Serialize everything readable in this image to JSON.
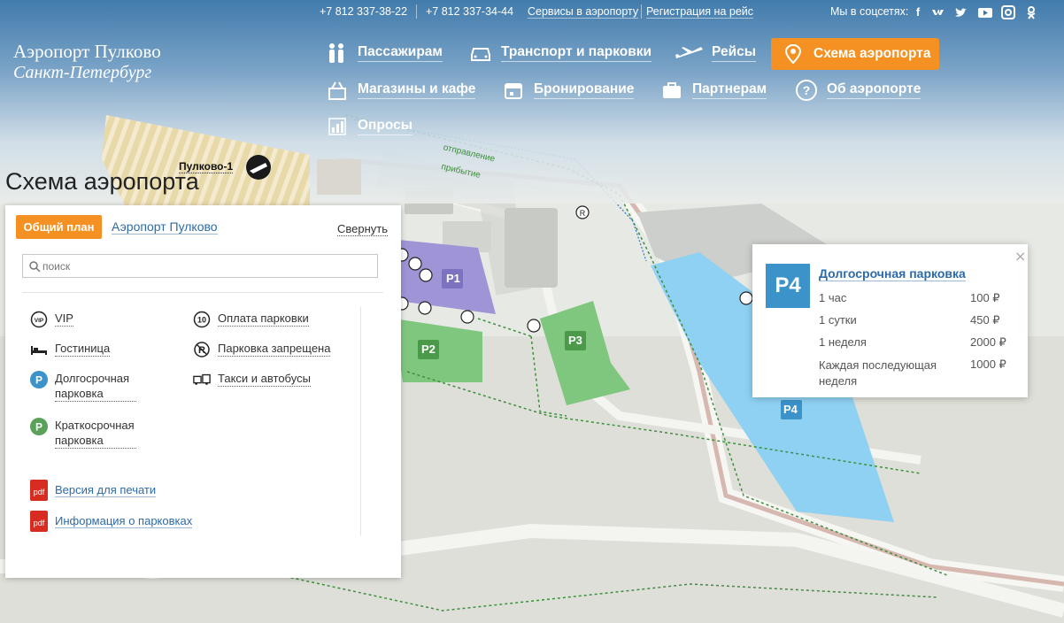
{
  "topbar": {
    "phone1": "+7 812 337-38-22",
    "phone2": "+7 812 337-34-44",
    "services_link": "Сервисы в аэропорту",
    "checkin_link": "Регистрация на рейс",
    "social_label": "Мы в соцсетях:",
    "social_icons": [
      "facebook-icon",
      "vk-icon",
      "twitter-icon",
      "youtube-icon",
      "instagram-icon",
      "odnoklassniki-icon"
    ]
  },
  "logo": {
    "line1": "Аэропорт Пулково",
    "line2": "Санкт-Петербург"
  },
  "nav": {
    "passengers": "Пассажирам",
    "transport": "Транспорт и парковки",
    "flights": "Рейсы",
    "scheme": "Схема аэропорта",
    "shops": "Магазины и кафе",
    "booking": "Бронирование",
    "partners": "Партнерам",
    "about": "Об аэропорте",
    "polls": "Опросы"
  },
  "page_title": "Схема аэропорта",
  "panel": {
    "tab_active": "Общий план",
    "tab_other": "Аэропорт Пулково",
    "collapse": "Свернуть",
    "search_placeholder": "поиск",
    "legend": {
      "vip": "VIP",
      "parking_payment": "Оплата парковки",
      "hotel": "Гостиница",
      "no_parking": "Парковка запрещена",
      "long_term": "Долгосрочная парковка",
      "taxi_bus": "Такси и автобусы",
      "short_term": "Краткосрочная парковка"
    },
    "print_version": "Версия для печати",
    "parking_info": "Информация о парковках",
    "pdf_label": "pdf"
  },
  "map": {
    "terminal_label": "Пулково-1",
    "departure_label": "отправление",
    "arrival_label": "прибытие",
    "parking_labels": [
      "P1",
      "P2",
      "P3",
      "P4"
    ]
  },
  "popup": {
    "badge": "P4",
    "title": "Долгосрочная парковка",
    "close": "×",
    "rows": [
      {
        "label": "1 час",
        "price": "100 ₽"
      },
      {
        "label": "1 сутки",
        "price": "450 ₽"
      },
      {
        "label": "1 неделя",
        "price": "2000 ₽"
      },
      {
        "label": "Каждая последующая неделя",
        "price": "1000 ₽"
      }
    ]
  },
  "colors": {
    "accent_orange": "#f59122",
    "link_blue": "#2d6aa8",
    "long_term_blue": "#3b93c9",
    "short_term_green": "#5aa15a",
    "pdf_red": "#d92c20"
  }
}
